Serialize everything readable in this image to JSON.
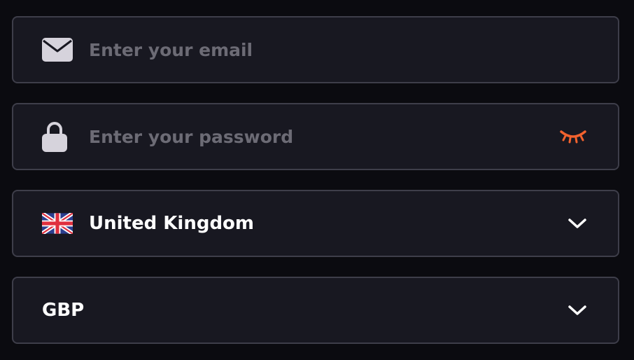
{
  "email": {
    "icon": "envelope-icon",
    "placeholder": "Enter your email",
    "value": ""
  },
  "password": {
    "icon": "lock-icon",
    "placeholder": "Enter your password",
    "value": "",
    "toggle_icon": "eye-closed-icon",
    "toggle_color": "#f2622e"
  },
  "country": {
    "icon": "uk-flag-icon",
    "selected": "United Kingdom",
    "chevron_icon": "chevron-down-icon"
  },
  "currency": {
    "selected": "GBP",
    "chevron_icon": "chevron-down-icon"
  },
  "colors": {
    "background": "#0b0b10",
    "field_bg": "#181821",
    "field_border": "#3e3e4a",
    "placeholder": "#6c6b75",
    "text": "#ffffff",
    "icon": "#d6d3dc",
    "accent": "#f2622e"
  }
}
